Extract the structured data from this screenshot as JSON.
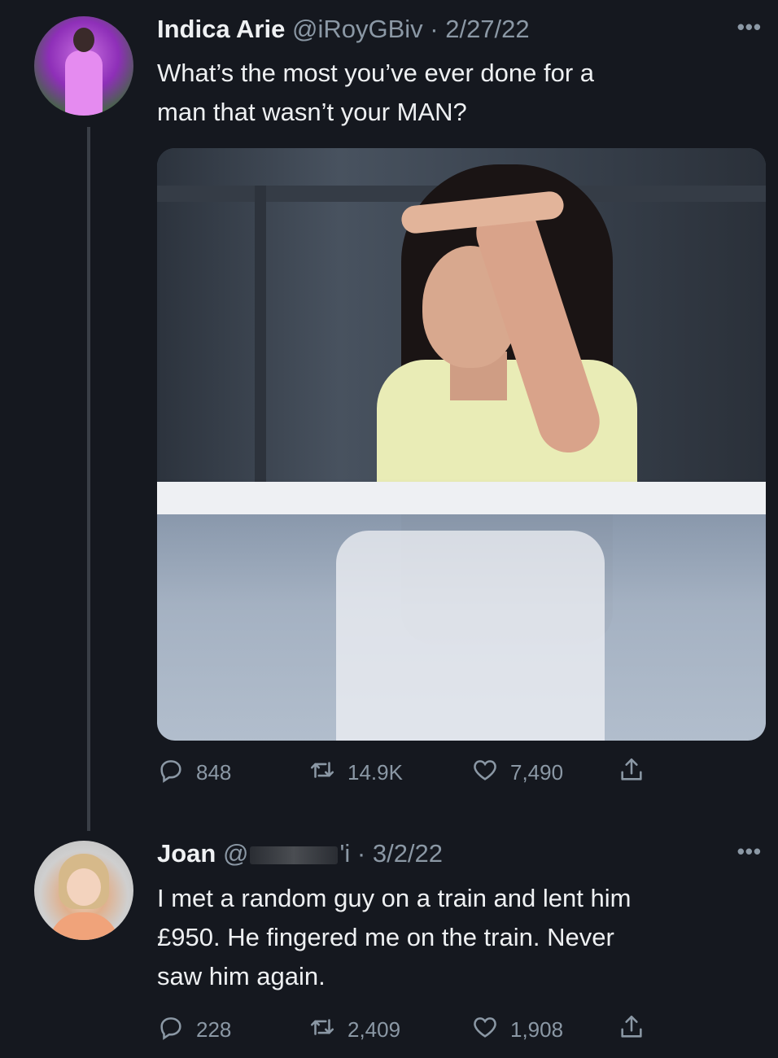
{
  "tweets": [
    {
      "name": "Indica Arie",
      "handle": "@iRoyGBiv",
      "date": "· 2/27/22",
      "text_lines": [
        "What’s the most you’ve ever done for a",
        "man that wasn’t your MAN?"
      ],
      "stats": {
        "replies": "848",
        "retweets": "14.9K",
        "likes": "7,490"
      }
    },
    {
      "name": "Joan",
      "handle_prefix": "@",
      "handle_suffix": "'i",
      "date": "· 3/2/22",
      "text_lines": [
        "I met a random guy on a train and lent him",
        "£950. He fingered me on the train. Never",
        "saw him again."
      ],
      "stats": {
        "replies": "228",
        "retweets": "2,409",
        "likes": "1,908"
      }
    }
  ],
  "more_label": "•••",
  "icons": [
    "reply-icon",
    "retweet-icon",
    "like-icon",
    "share-icon",
    "more-icon"
  ],
  "colors": {
    "background": "#15181f",
    "text": "#e7e9ea",
    "secondary": "#8b98a5",
    "thread_line": "#3a3f47"
  }
}
